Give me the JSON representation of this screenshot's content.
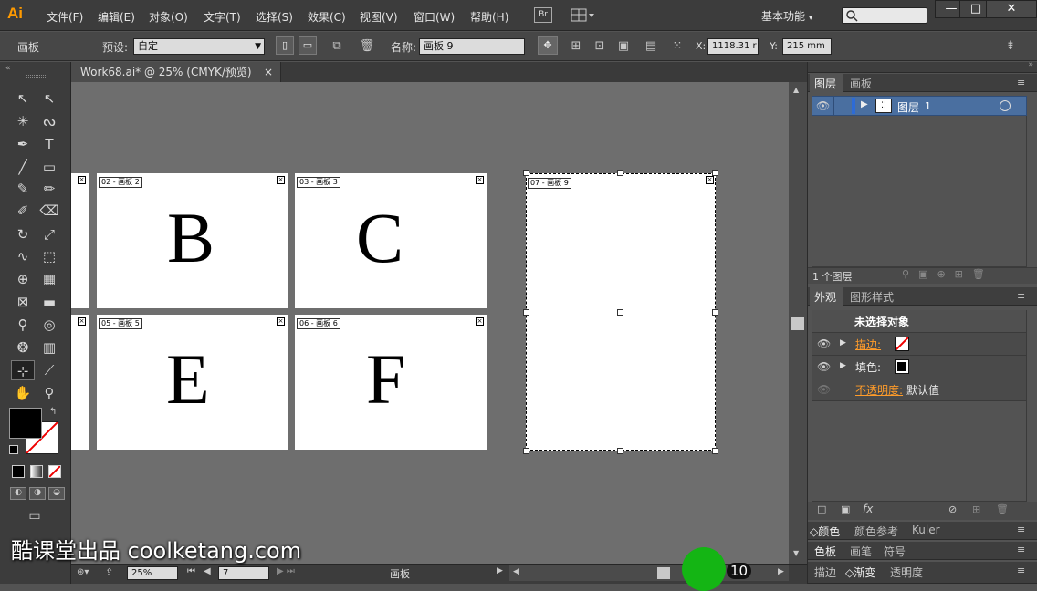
{
  "app": {
    "logo": "Ai",
    "bridge": "Br",
    "workspace": "基本功能",
    "workspace_arrow": "▾"
  },
  "menu": [
    "文件(F)",
    "编辑(E)",
    "对象(O)",
    "文字(T)",
    "选择(S)",
    "效果(C)",
    "视图(V)",
    "窗口(W)",
    "帮助(H)"
  ],
  "window_buttons": {
    "minimize": "—",
    "maximize": "□",
    "close": "✕"
  },
  "control": {
    "tool_name": "画板",
    "preset_label": "预设:",
    "preset_value": "自定",
    "name_label": "名称:",
    "name_value": "画板 9",
    "x_label": "X:",
    "x_value": "1118.31 r",
    "y_label": "Y:",
    "y_value": "215 mm"
  },
  "document": {
    "tab_title": "Work68.ai* @ 25% (CMYK/预览)",
    "close": "×"
  },
  "artboards": [
    {
      "label": "02 - 画板 2",
      "letter": "B"
    },
    {
      "label": "03 - 画板 3",
      "letter": "C"
    },
    {
      "label": "05 - 画板 5",
      "letter": "E"
    },
    {
      "label": "06 - 画板 6",
      "letter": "F"
    },
    {
      "label": "07 - 画板 9",
      "letter": ""
    }
  ],
  "status": {
    "zoom": "25%",
    "page": "7",
    "tool": "画板"
  },
  "layers_panel": {
    "tabs": [
      "图层",
      "画板"
    ],
    "layer_name": "图层",
    "layer_num": "1",
    "count": "1 个图层"
  },
  "appearance_panel": {
    "tabs": [
      "外观",
      "图形样式"
    ],
    "header": "未选择对象",
    "rows": [
      {
        "label": "描边:",
        "link": true
      },
      {
        "label": "填色:",
        "link": false
      },
      {
        "label": "不透明度:",
        "value": "默认值",
        "link": true
      }
    ]
  },
  "collapsed_panels": [
    [
      "颜色",
      "颜色参考",
      "Kuler"
    ],
    [
      "色板",
      "画笔",
      "符号"
    ],
    [
      "描边",
      "渐变",
      "透明度"
    ]
  ],
  "watermark": "酷课堂出品 coolketang.com",
  "click_count": "10",
  "colors": {
    "accent_orange": "#ff9a00",
    "link_orange": "#ff9c2a",
    "cursor_green": "#14b514",
    "layer_blue": "#4a6fa0"
  }
}
